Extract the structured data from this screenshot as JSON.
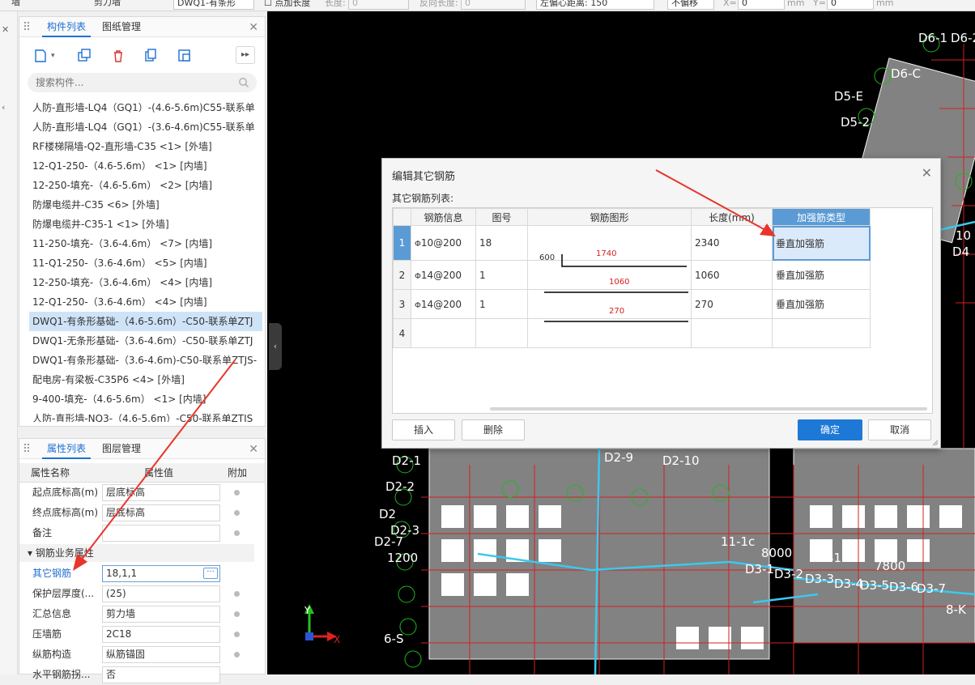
{
  "toolbar": {
    "item1": "墙",
    "item2": "剪力墙",
    "item3": "DWQ1-有条形",
    "add_length_label": "点加长度",
    "length_label": "长度:",
    "length_value": "0",
    "reverse_length_label": "反向长度:",
    "reverse_length_value": "0",
    "left_offset": "左偏心距离: 150",
    "offset_mode": "不偏移",
    "x_label": "X=",
    "x_value": "0",
    "y_label": "Y=",
    "y_value": "0",
    "unit_mm": "mm"
  },
  "components_panel": {
    "tabs": [
      "构件列表",
      "图纸管理"
    ],
    "search_placeholder": "搜索构件...",
    "items": [
      "人防-直形墙-LQ4（GQ1）-(4.6-5.6m)C55-联系单",
      "人防-直形墙-LQ4（GQ1）-(3.6-4.6m)C55-联系单",
      "RF楼梯隔墙-Q2-直形墙-C35 <1> [外墙]",
      "12-Q1-250-（4.6-5.6m） <1> [内墙]",
      "12-250-填充-（4.6-5.6m） <2> [内墙]",
      "防爆电缆井-C35 <6> [外墙]",
      "防爆电缆井-C35-1 <1> [外墙]",
      "11-250-填充-（3.6-4.6m） <7> [内墙]",
      "11-Q1-250-（3.6-4.6m） <5> [内墙]",
      "12-250-填充-（3.6-4.6m） <4> [内墙]",
      "12-Q1-250-（3.6-4.6m） <4> [内墙]",
      "DWQ1-有条形基础-（4.6-5.6m）-C50-联系单ZTJ",
      "DWQ1-无条形基础-（3.6-4.6m）-C50-联系单ZTJ",
      "DWQ1-有条形基础-（3.6-4.6m)-C50-联系单ZTJS-",
      "配电房-有梁板-C35P6 <4> [外墙]",
      "9-400-填充-（4.6-5.6m） <1> [内墙]",
      "人防-直形墙-NQ3-（4.6-5.6m）-C50-联系单ZTJS"
    ]
  },
  "properties_panel": {
    "tabs": [
      "属性列表",
      "图层管理"
    ],
    "headers": {
      "name": "属性名称",
      "value": "属性值",
      "extra": "附加"
    },
    "rows_top": [
      {
        "name": "起点底标高(m)",
        "value": "层底标高"
      },
      {
        "name": "终点底标高(m)",
        "value": "层底标高"
      },
      {
        "name": "备注",
        "value": ""
      }
    ],
    "group_label": "钢筋业务属性",
    "rows_group": [
      {
        "name": "其它钢筋",
        "value": "18,1,1"
      },
      {
        "name": "保护层厚度(...",
        "value": "(25)"
      },
      {
        "name": "汇总信息",
        "value": "剪力墙"
      },
      {
        "name": "压墙筋",
        "value": "2C18"
      },
      {
        "name": "纵筋构造",
        "value": "纵筋锚固"
      },
      {
        "name": "水平钢筋拐...",
        "value": "否"
      }
    ],
    "ellipsis": "···"
  },
  "dialog": {
    "title": "编辑其它钢筋",
    "list_label": "其它钢筋列表:",
    "columns": [
      "钢筋信息",
      "图号",
      "钢筋图形",
      "长度(mm)",
      "加强筋类型"
    ],
    "rows": [
      {
        "no": "1",
        "info": "10@200",
        "fig": "18",
        "shape_a": "600",
        "shape_b": "1740",
        "length": "2340",
        "type": "垂直加强筋"
      },
      {
        "no": "2",
        "info": "14@200",
        "fig": "1",
        "shape_a": "",
        "shape_b": "1060",
        "length": "1060",
        "type": "垂直加强筋"
      },
      {
        "no": "3",
        "info": "14@200",
        "fig": "1",
        "shape_a": "",
        "shape_b": "270",
        "length": "270",
        "type": "垂直加强筋"
      },
      {
        "no": "4",
        "info": "",
        "fig": "",
        "shape_a": "",
        "shape_b": "",
        "length": "",
        "type": ""
      }
    ],
    "rebar_symbol": "Φ",
    "btn_insert": "插入",
    "btn_delete": "删除",
    "btn_ok": "确定",
    "btn_cancel": "取消"
  },
  "cad_labels": [
    "D6-1",
    "D6-2",
    "D5-E",
    "D5-2",
    "D6-C",
    "D2-9",
    "D2-10",
    "D2-1",
    "D2-2",
    "D2",
    "D2-3",
    "D2-7",
    "11-1c",
    "D3-1",
    "D3-2",
    "D3-3",
    "D3-4",
    "D3-5",
    "D3-6",
    "D3-7",
    "8-K",
    "6-S",
    "1200",
    "8000",
    "8100",
    "7800",
    "D4",
    "10"
  ],
  "axis": {
    "x": "X",
    "y": "Y"
  },
  "colors": {
    "accent": "#1f6fd1",
    "selection": "#cfe3f8",
    "grid_header_highlight": "#5b9bd5",
    "primary_button": "#1e79d6",
    "canvas": "#000000",
    "annotation_arrow": "#e8352c"
  }
}
